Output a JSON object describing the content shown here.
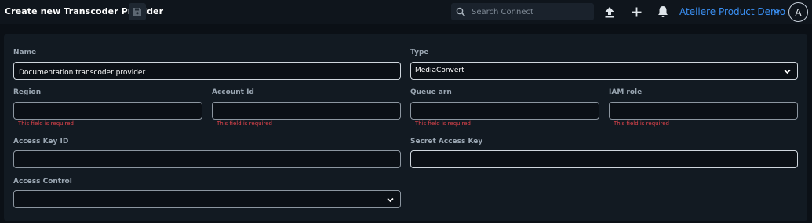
{
  "header": {
    "title": "Create new Transcoder Provider",
    "save_icon": "save-icon",
    "search": {
      "placeholder": "Search Connect",
      "value": ""
    },
    "actions": [
      "upload-icon",
      "plus-icon",
      "bell-icon"
    ],
    "organization": "Ateliere Product Demo",
    "avatar_initial": "A"
  },
  "form": {
    "name": {
      "label": "Name",
      "value": "Documentation transcoder provider"
    },
    "type": {
      "label": "Type",
      "value": "MediaConvert"
    },
    "region": {
      "label": "Region",
      "value": "",
      "error": "This field is required"
    },
    "account_id": {
      "label": "Account Id",
      "value": "",
      "error": "This field is required"
    },
    "queue_arn": {
      "label": "Queue arn",
      "value": "",
      "error": "This field is required"
    },
    "iam_role": {
      "label": "IAM role",
      "value": "",
      "error": "This field is required"
    },
    "access_key_id": {
      "label": "Access Key ID",
      "value": ""
    },
    "secret_access_key": {
      "label": "Secret Access Key",
      "value": ""
    },
    "access_control": {
      "label": "Access Control",
      "value": ""
    }
  },
  "colors": {
    "background": "#0b1016",
    "panel": "#121a22",
    "accent": "#3a8ff2",
    "error": "#e0434b"
  }
}
